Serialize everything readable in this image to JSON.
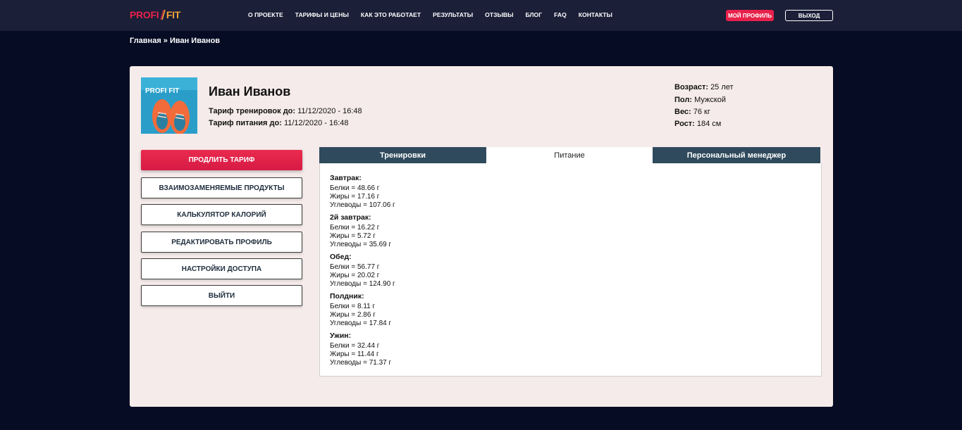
{
  "header": {
    "logo_left": "PROFI",
    "logo_right": "FIT",
    "nav": [
      "О ПРОЕКТЕ",
      "ТАРИФЫ И ЦЕНЫ",
      "КАК ЭТО РАБОТАЕТ",
      "РЕЗУЛЬТАТЫ",
      "ОТЗЫВЫ",
      "БЛОГ",
      "FAQ",
      "КОНТАКТЫ"
    ],
    "my_profile_label": "МОЙ ПРОФИЛЬ",
    "logout_label": "ВЫХОД"
  },
  "breadcrumb": "Главная » Иван Иванов",
  "profile": {
    "avatar_logo": "PROFI FIT",
    "name": "Иван Иванов",
    "training_tariff_label": "Тариф тренировок до:",
    "training_tariff_value": "11/12/2020 - 16:48",
    "nutrition_tariff_label": "Тариф питания до:",
    "nutrition_tariff_value": "11/12/2020 - 16:48",
    "age_label": "Возраст:",
    "age_value": "25 лет",
    "gender_label": "Пол:",
    "gender_value": "Мужской",
    "weight_label": "Вес:",
    "weight_value": "76 кг",
    "height_label": "Рост:",
    "height_value": "184 см"
  },
  "sidebar": {
    "buttons": [
      "ПРОДЛИТЬ ТАРИФ",
      "ВЗАИМОЗАМЕНЯЕМЫЕ ПРОДУКТЫ",
      "КАЛЬКУЛЯТОР КАЛОРИЙ",
      "РЕДАКТИРОВАТЬ ПРОФИЛЬ",
      "НАСТРОЙКИ ДОСТУПА",
      "ВЫЙТИ"
    ]
  },
  "tabs": [
    "Тренировки",
    "Питание",
    "Персональный менеджер"
  ],
  "meals": [
    {
      "title": "Завтрак:",
      "lines": [
        "Белки = 48.66 г",
        "Жиры = 17.16 г",
        "Углеводы = 107.06 г"
      ]
    },
    {
      "title": "2й завтрак:",
      "lines": [
        "Белки = 16.22 г",
        "Жиры = 5.72 г",
        "Углеводы = 35.69 г"
      ]
    },
    {
      "title": "Обед:",
      "lines": [
        "Белки = 56.77 г",
        "Жиры = 20.02 г",
        "Углеводы = 124.90 г"
      ]
    },
    {
      "title": "Полдник:",
      "lines": [
        "Белки = 8.11 г",
        "Жиры = 2.86 г",
        "Углеводы = 17.84 г"
      ]
    },
    {
      "title": "Ужин:",
      "lines": [
        "Белки = 32.44 г",
        "Жиры = 11.44 г",
        "Углеводы = 71.37 г"
      ]
    }
  ],
  "colors": {
    "page_bg": "#050c24",
    "topbar_bg": "#1b1f38",
    "accent": "#e8214a",
    "card_bg": "#f5ebea",
    "tab_dark": "#2f4a5c"
  }
}
